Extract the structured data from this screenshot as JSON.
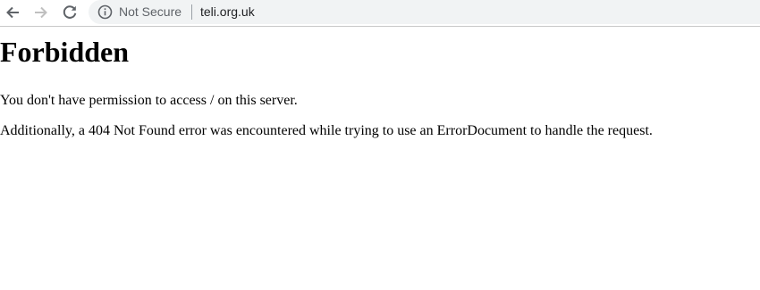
{
  "browser": {
    "security_label": "Not Secure",
    "url": "teli.org.uk",
    "icons": {
      "back": "arrow-left-icon",
      "forward": "arrow-right-icon",
      "reload": "reload-icon",
      "info": "info-circle-icon"
    },
    "colors": {
      "omnibox_bg": "#f1f3f4",
      "icon_active": "#5f6368",
      "icon_disabled": "#c0c0c0"
    }
  },
  "page": {
    "heading": "Forbidden",
    "message": "You don't have permission to access / on this server.",
    "details": "Additionally, a 404 Not Found error was encountered while trying to use an ErrorDocument to handle the request."
  }
}
